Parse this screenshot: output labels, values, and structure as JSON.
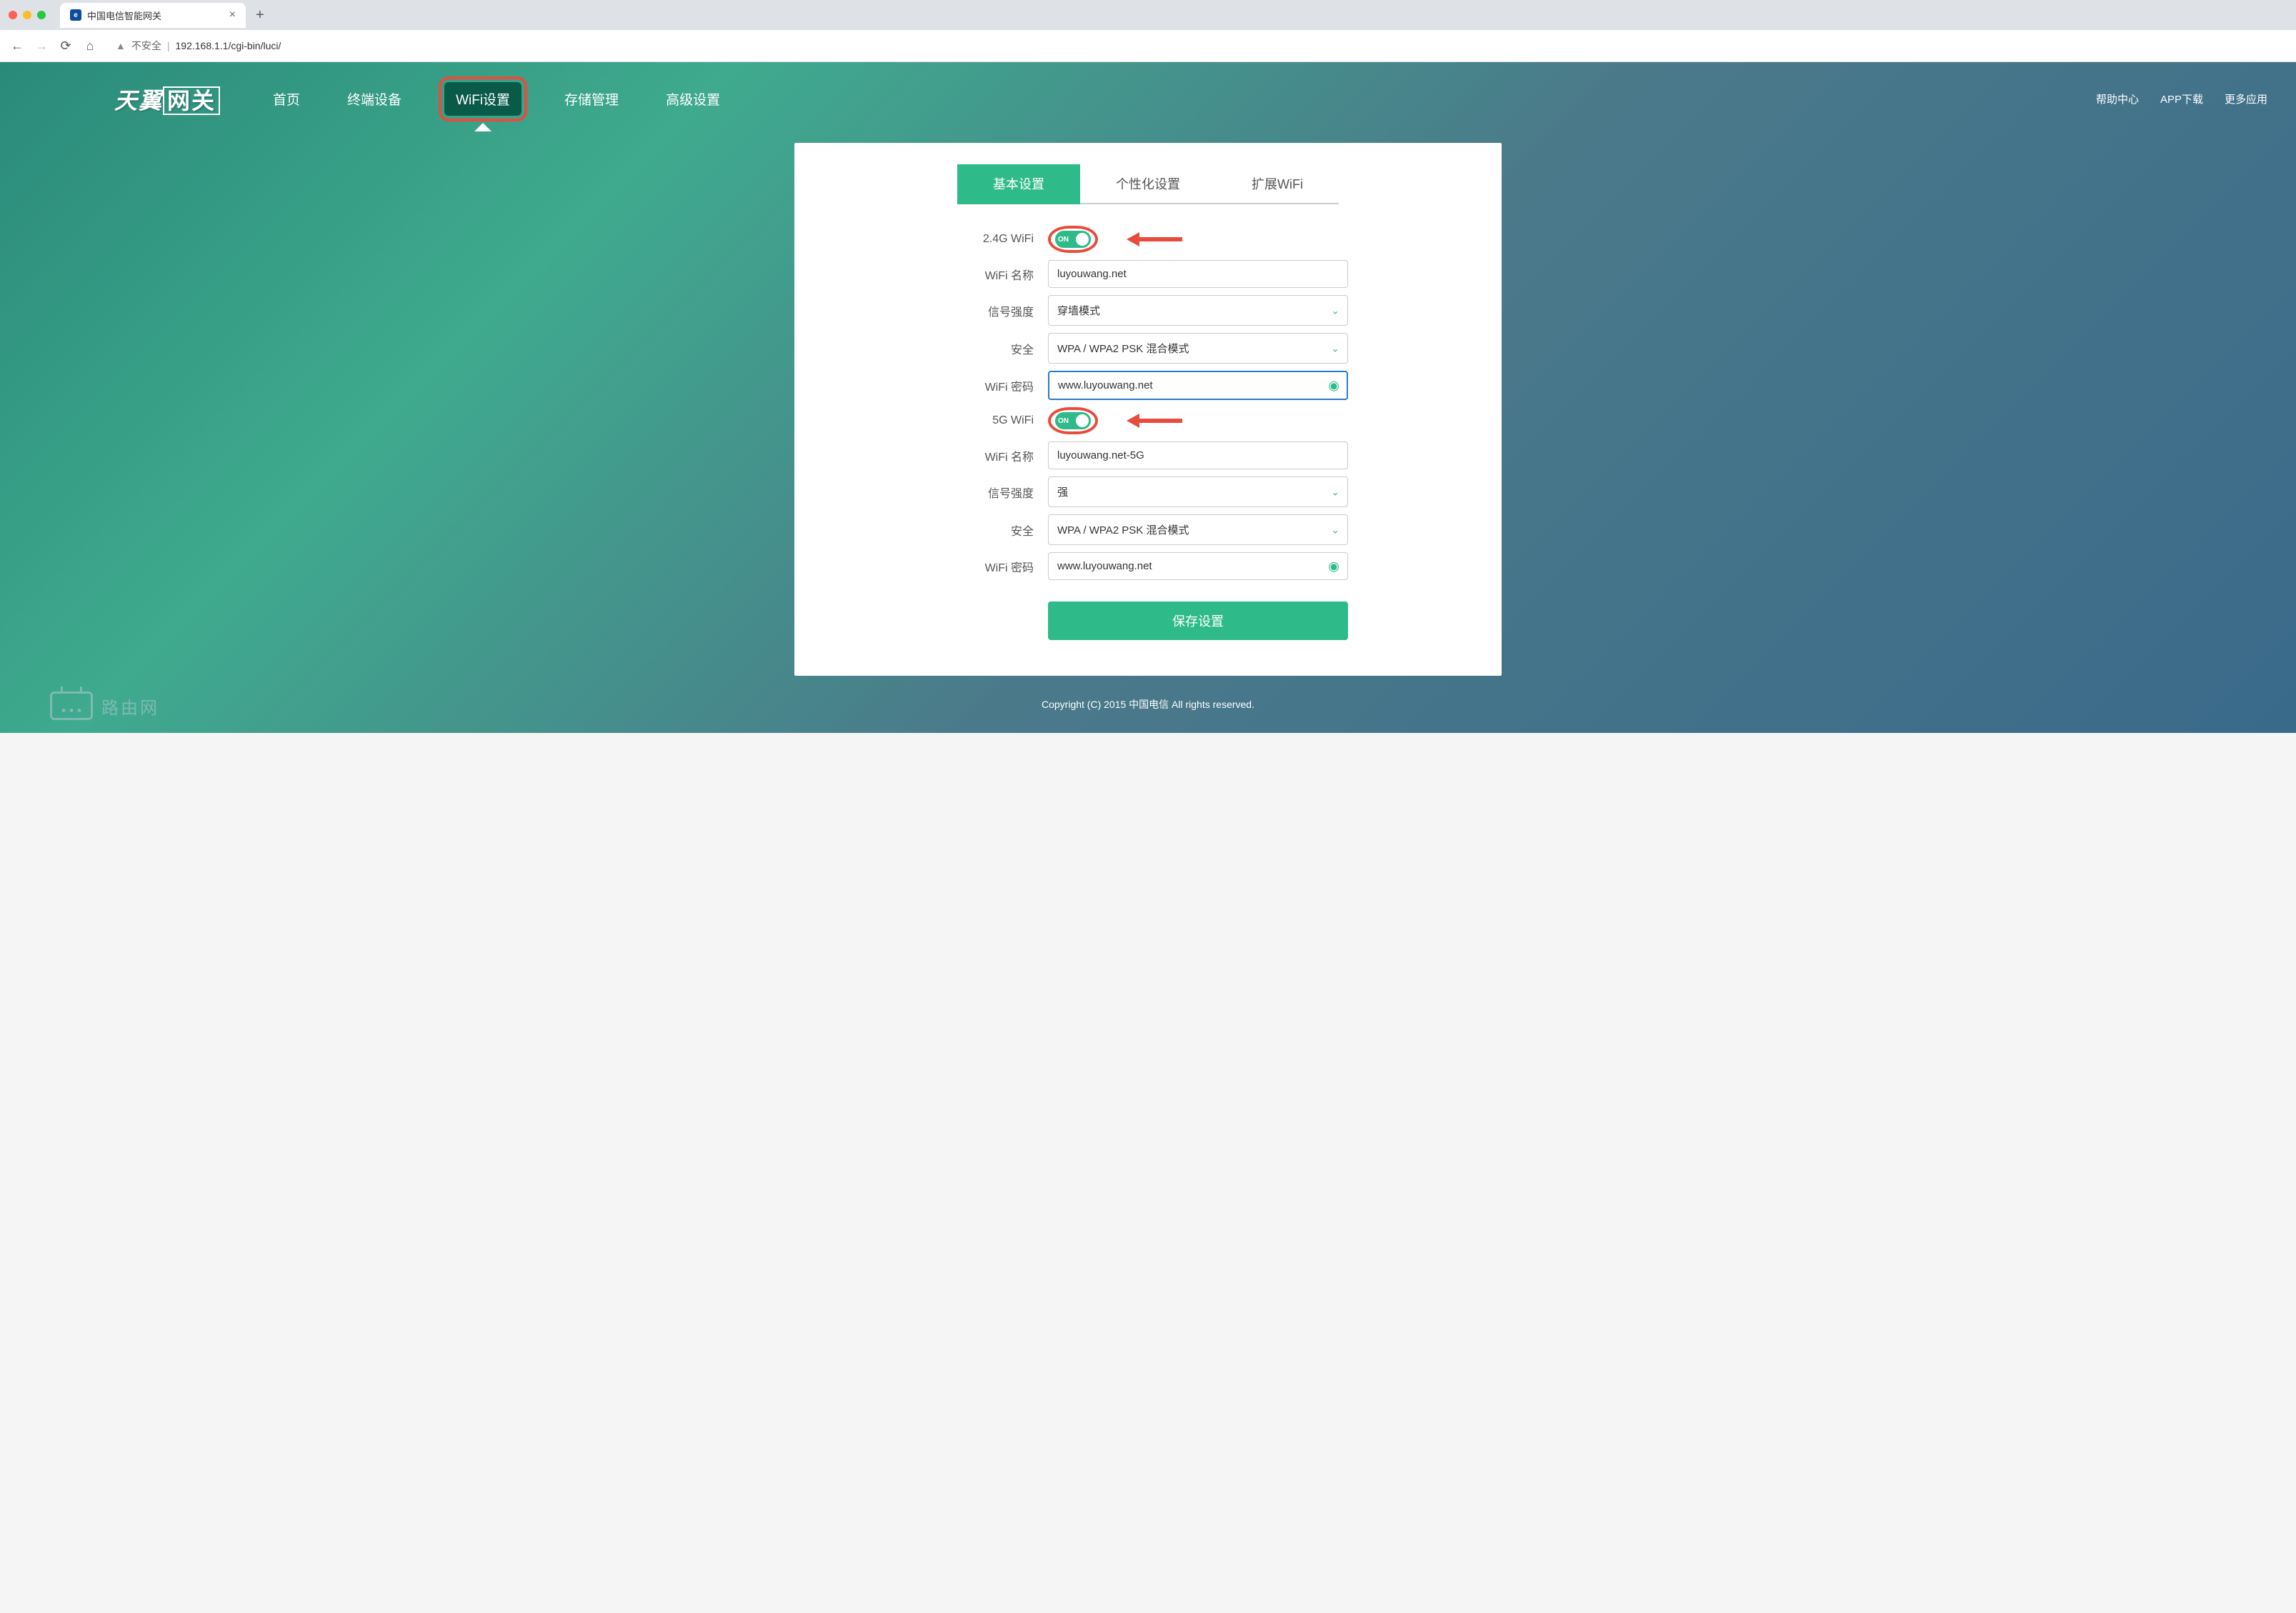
{
  "browser": {
    "tab_title": "中国电信智能网关",
    "insecure_label": "不安全",
    "url": "192.168.1.1/cgi-bin/luci/"
  },
  "logo": {
    "text1": "天翼",
    "text2": "网关"
  },
  "nav": {
    "items": [
      "首页",
      "终端设备",
      "WiFi设置",
      "存储管理",
      "高级设置"
    ],
    "active_index": 2
  },
  "right_nav": [
    "帮助中心",
    "APP下载",
    "更多应用"
  ],
  "sub_tabs": {
    "items": [
      "基本设置",
      "个性化设置",
      "扩展WiFi"
    ],
    "active_index": 0
  },
  "form": {
    "wifi24": {
      "toggle_label": "2.4G WiFi",
      "toggle_state": "ON",
      "name_label": "WiFi 名称",
      "name_value": "luyouwang.net",
      "signal_label": "信号强度",
      "signal_value": "穿墙模式",
      "security_label": "安全",
      "security_value": "WPA / WPA2 PSK 混合模式",
      "password_label": "WiFi 密码",
      "password_value": "www.luyouwang.net"
    },
    "wifi5": {
      "toggle_label": "5G WiFi",
      "toggle_state": "ON",
      "name_label": "WiFi 名称",
      "name_value": "luyouwang.net-5G",
      "signal_label": "信号强度",
      "signal_value": "强",
      "security_label": "安全",
      "security_value": "WPA / WPA2 PSK 混合模式",
      "password_label": "WiFi 密码",
      "password_value": "www.luyouwang.net"
    },
    "save_label": "保存设置"
  },
  "footer": "Copyright (C) 2015 中国电信 All rights reserved.",
  "watermark": "路由网"
}
